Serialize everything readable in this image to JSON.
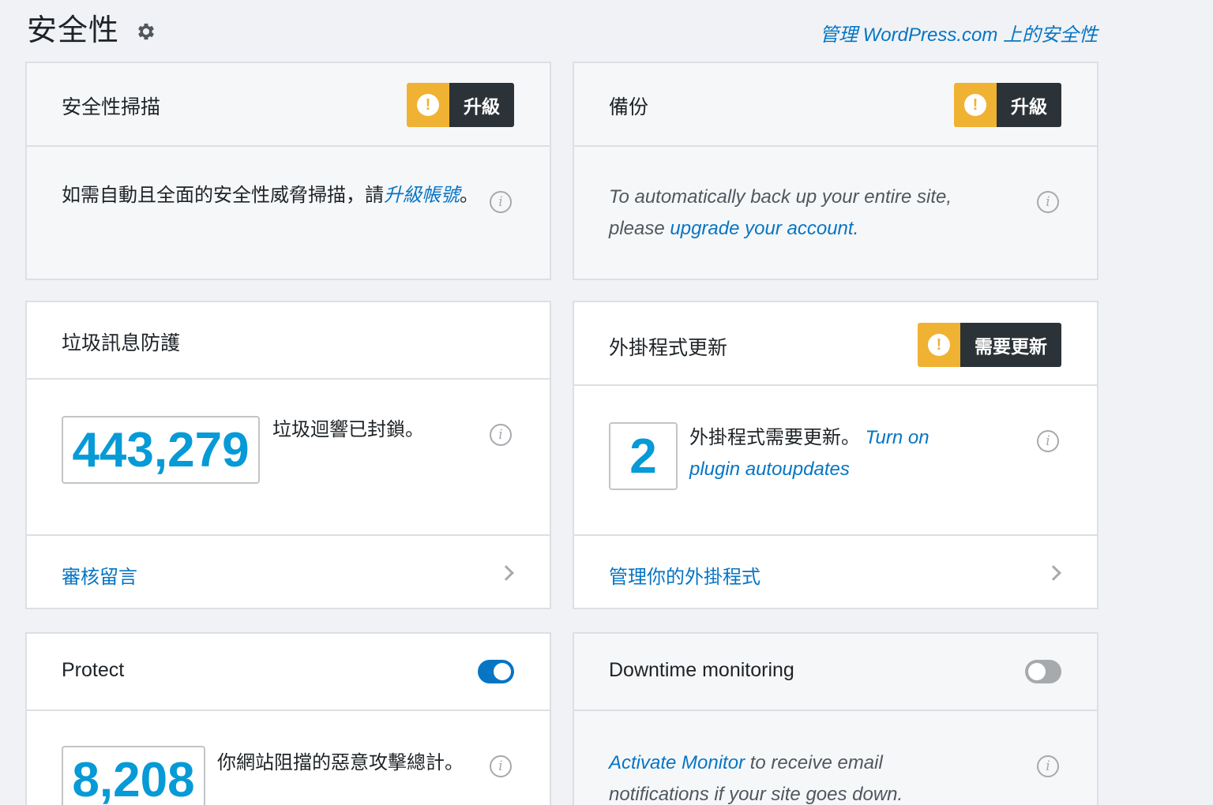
{
  "header": {
    "title": "安全性",
    "settings_icon": "gear-icon",
    "manage_link": "管理 WordPress.com 上的安全性"
  },
  "cards": {
    "scan": {
      "title": "安全性掃描",
      "badge": "升級",
      "text_before": "如需自動且全面的安全性威脅掃描，請",
      "text_link": "升級帳號",
      "text_after": "。"
    },
    "backup": {
      "title": "備份",
      "badge": "升級",
      "text_before": "To automatically back up your entire site,",
      "text_mid": "please ",
      "text_link": "upgrade your account",
      "text_after": "."
    },
    "spam": {
      "title": "垃圾訊息防護",
      "count": "443,279",
      "text": "垃圾迴響已封鎖。",
      "footer_link": "審核留言"
    },
    "plugins": {
      "title": "外掛程式更新",
      "badge": "需要更新",
      "count": "2",
      "text": "外掛程式需要更新。",
      "link_line1": "Turn on",
      "link_line2": "plugin autoupdates",
      "footer_link": "管理你的外掛程式"
    },
    "protect": {
      "title": "Protect",
      "toggle_on": true,
      "count": "8,208",
      "text": "你網站阻擋的惡意攻擊總計。"
    },
    "downtime": {
      "title": "Downtime monitoring",
      "toggle_on": false,
      "text_link": "Activate Monitor",
      "text_line1_rest": " to receive email",
      "text_line2": "notifications if your site goes down."
    }
  },
  "colors": {
    "accent": "#0675c4",
    "stat_blue": "#069ad6",
    "warning": "#f0b232",
    "badge_dark": "#2c3338",
    "background": "#f0f2f5"
  }
}
